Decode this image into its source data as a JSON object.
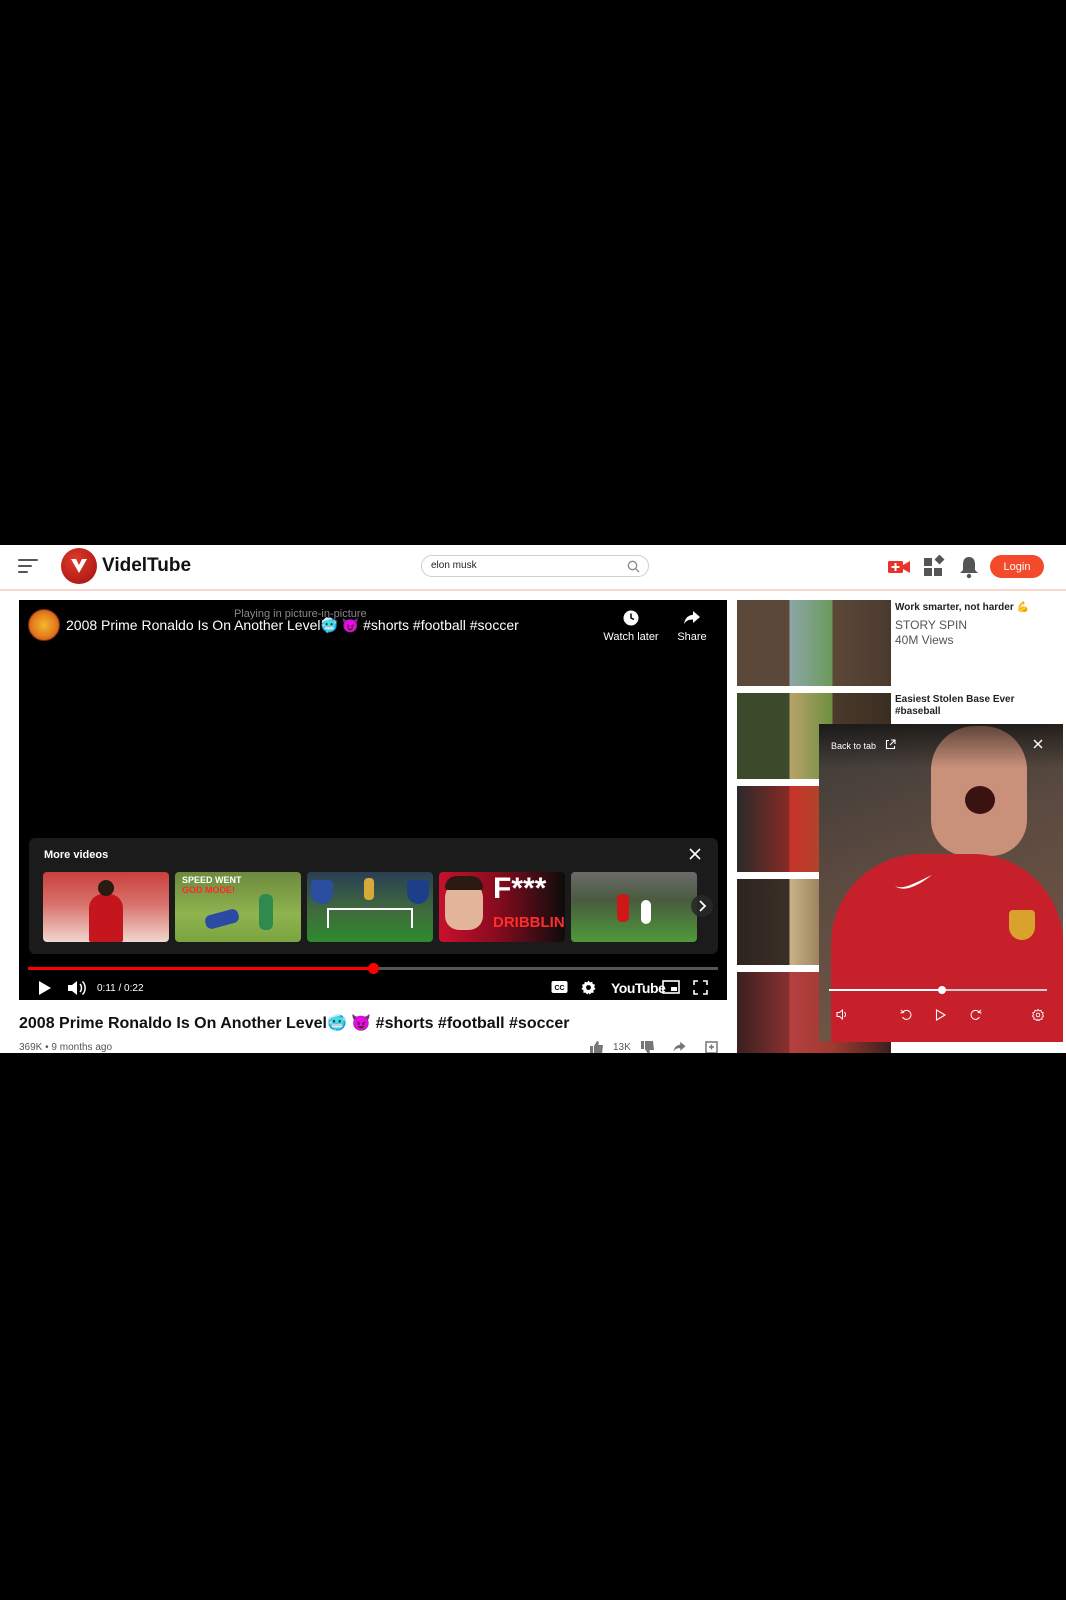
{
  "header": {
    "brand": "VidelTube",
    "search_value": "elon musk",
    "login_label": "Login"
  },
  "player": {
    "pip_note": "Playing in picture-in-picture",
    "title": "2008 Prime Ronaldo Is On Another Level🥶 😈 #shorts #football #soccer",
    "watch_later_label": "Watch later",
    "share_label": "Share",
    "more_videos_label": "More videos",
    "thumbs": [
      {
        "caption": ""
      },
      {
        "caption": "SPEED WENT",
        "caption2": "GOD MODE!"
      },
      {
        "caption": ""
      },
      {
        "caption": "F***",
        "caption2": "DRIBBLING"
      },
      {
        "caption": ""
      }
    ],
    "time": "0:11 / 0:22",
    "progress": 0.5,
    "youtube_word": "YouTube"
  },
  "video": {
    "title": "2008 Prime Ronaldo Is On Another Level🥶 😈 #shorts #football #soccer",
    "meta": "369K • 9 months ago",
    "likes": "13K"
  },
  "sidebar": {
    "items": [
      {
        "title": "Work smarter, not harder 💪",
        "channel": "STORY SPIN",
        "views": "40M Views"
      },
      {
        "title": "Easiest Stolen Base Ever #baseball",
        "channel": "",
        "views": ""
      }
    ]
  },
  "pip": {
    "back_label": "Back to tab",
    "progress": 0.52
  },
  "colors": {
    "accent": "#f24a2b",
    "progress_red": "#ff0000"
  }
}
